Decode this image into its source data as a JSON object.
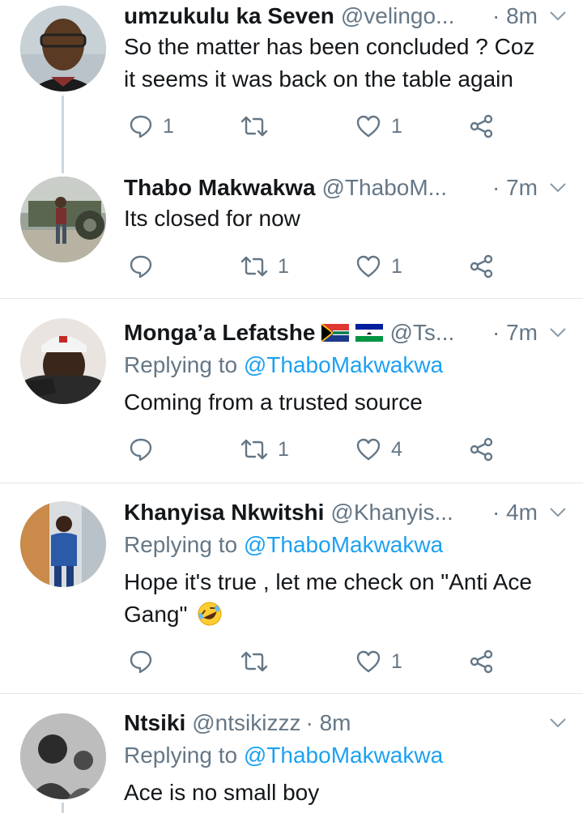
{
  "tweets": [
    {
      "name": "umzukulu ka Seven",
      "handle": "@velingo...",
      "time": "· 8m",
      "text_lines": [
        "So the matter has been concluded ? Coz",
        "it seems it was back on the table again"
      ],
      "reply_count": "1",
      "retweet_count": "",
      "like_count": "1"
    },
    {
      "name": "Thabo Makwakwa",
      "handle": "@ThaboM...",
      "time": "· 7m",
      "text_lines": [
        "Its closed for now"
      ],
      "reply_count": "",
      "retweet_count": "1",
      "like_count": "1"
    },
    {
      "name": "Monga’a Lefatshe",
      "handle": "@Ts...",
      "time": "· 7m",
      "replying_label": "Replying to",
      "replying_mention": "@ThaboMakwakwa",
      "text_lines": [
        "Coming from a trusted source"
      ],
      "reply_count": "",
      "retweet_count": "1",
      "like_count": "4"
    },
    {
      "name": "Khanyisa Nkwitshi",
      "handle": "@Khanyis...",
      "time": "· 4m",
      "replying_label": "Replying to",
      "replying_mention": "@ThaboMakwakwa",
      "text_lines": [
        "Hope it's true , let me check on \"Anti Ace",
        "Gang\""
      ],
      "reply_count": "",
      "retweet_count": "",
      "like_count": "1"
    },
    {
      "name": "Ntsiki",
      "handle": "@ntsikizzz",
      "time": "· 8m",
      "replying_label": "Replying to",
      "replying_mention": "@ThaboMakwakwa",
      "text_lines": [
        "Ace is no small boy"
      ]
    }
  ],
  "colors": {
    "text": "#14171a",
    "secondary": "#657786",
    "link": "#1da1f2",
    "divider": "#e1e8ed",
    "thread_line": "#ccd6dd"
  },
  "icons": {
    "reply": "reply-icon",
    "retweet": "retweet-icon",
    "like": "heart-icon",
    "share": "share-icon",
    "menu": "chevron-down-icon",
    "emoji": "rolling-laughing-emoji",
    "flags": [
      "south-africa-flag-icon",
      "lesotho-flag-icon"
    ]
  }
}
